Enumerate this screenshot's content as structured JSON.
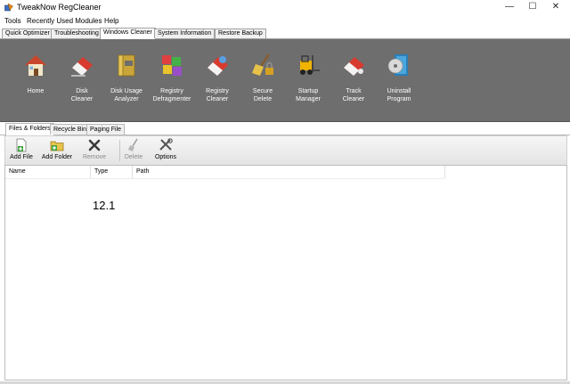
{
  "window": {
    "title": "TweakNow RegCleaner",
    "minimize": "—",
    "maximize": "☐",
    "close": "✕"
  },
  "menu": [
    "Tools",
    "Recently Used Modules",
    "Help"
  ],
  "top_tabs": [
    "Quick Optimizer",
    "Troubleshooting",
    "Windows Cleaner",
    "System Information",
    "Restore Backup"
  ],
  "active_top_tab": "Windows Cleaner",
  "ribbon": [
    {
      "label": "Home",
      "icon": "house-icon"
    },
    {
      "label": "Disk\nCleaner",
      "icon": "eraser-icon"
    },
    {
      "label": "Disk Usage\nAnalyzer",
      "icon": "folder-icon"
    },
    {
      "label": "Registry\nDefragmenter",
      "icon": "cubes-icon"
    },
    {
      "label": "Registry\nCleaner",
      "icon": "eraser-icon"
    },
    {
      "label": "Secure\nDelete",
      "icon": "broom-lock-icon"
    },
    {
      "label": "Startup\nManager",
      "icon": "forklift-icon"
    },
    {
      "label": "Track\nCleaner",
      "icon": "eraser-icon"
    },
    {
      "label": "Uninstall\nProgram",
      "icon": "disc-box-icon"
    }
  ],
  "sub_tabs": [
    "Files & Folders",
    "Recycle Bin",
    "Paging File"
  ],
  "active_sub_tab": "Files & Folders",
  "toolbar": {
    "add_file": "Add File",
    "add_folder": "Add Folder",
    "remove": "Remove",
    "delete": "Delete",
    "options": "Options"
  },
  "columns": [
    "Name",
    "Type",
    "Path"
  ],
  "overlay_text": "12.1"
}
